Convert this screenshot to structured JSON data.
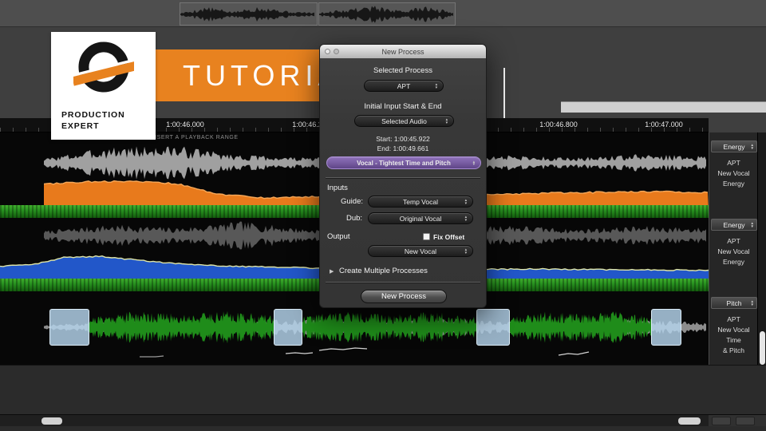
{
  "branding": {
    "tutorial": "TUTORIAL",
    "producer_line1": "PRODUCTION",
    "producer_line2": "EXPERT"
  },
  "ruler": {
    "hint": "DRAG TO INSERT A PLAYBACK RANGE",
    "ticks": [
      "1:00:46.000",
      "1:00:46.200",
      "1:00:46.800",
      "1:00:47.000"
    ]
  },
  "dialog": {
    "title": "New Process",
    "selected_process_label": "Selected Process",
    "process_type": "APT",
    "initial_input_label": "Initial Input Start & End",
    "input_range": "Selected Audio",
    "start": "Start: 1:00:45.922",
    "end": "End: 1:00:49.661",
    "preset": "Vocal - Tightest Time and Pitch",
    "inputs_label": "Inputs",
    "guide_label": "Guide:",
    "guide": "Temp Vocal",
    "dub_label": "Dub:",
    "dub": "Original Vocal",
    "output_label": "Output",
    "fix_offset": "Fix Offset",
    "output": "New Vocal",
    "create_multiple": "Create Multiple Processes",
    "submit": "New Process"
  },
  "side_panels": [
    {
      "header": "Energy",
      "lines": [
        "APT",
        "New Vocal",
        "Energy"
      ]
    },
    {
      "header": "Energy",
      "lines": [
        "APT",
        "New Vocal",
        "Energy"
      ]
    },
    {
      "header": "Pitch",
      "lines": [
        "APT",
        "New Vocal",
        "Time",
        "& Pitch"
      ]
    }
  ],
  "colors": {
    "accent_orange": "#E8821F",
    "energy_orange": "#E87A1C",
    "energy_blue": "#2257C9",
    "track_green": "#27921F",
    "preset_purple": "#7B5FA5"
  }
}
